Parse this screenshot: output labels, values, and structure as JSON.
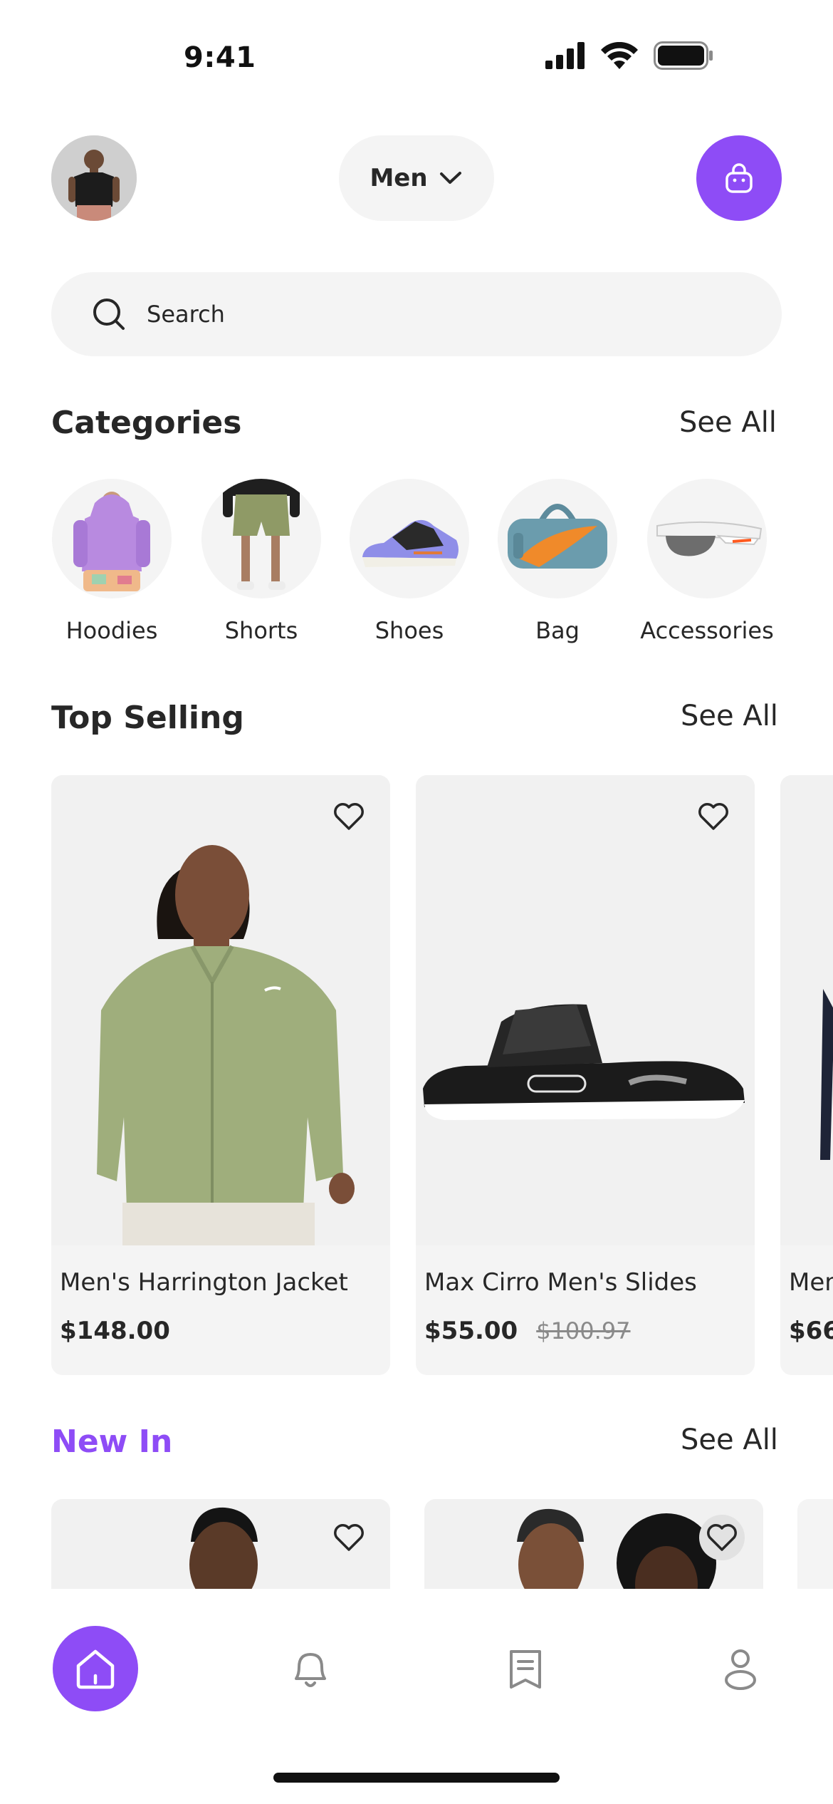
{
  "status_bar": {
    "time": "9:41"
  },
  "header": {
    "gender_selected": "Men",
    "avatar_icon": "user-avatar",
    "cart_icon": "shopping-bag-icon"
  },
  "search": {
    "placeholder": "Search"
  },
  "categories": {
    "title": "Categories",
    "see_all": "See All",
    "items": [
      {
        "label": "Hoodies",
        "icon": "hoodie-image"
      },
      {
        "label": "Shorts",
        "icon": "shorts-image"
      },
      {
        "label": "Shoes",
        "icon": "shoe-image"
      },
      {
        "label": "Bag",
        "icon": "bag-image"
      },
      {
        "label": "Accessories",
        "icon": "sunglasses-image"
      }
    ]
  },
  "top_selling": {
    "title": "Top Selling",
    "see_all": "See All",
    "products": [
      {
        "name": "Men's Harrington Jacket",
        "price": "$148.00",
        "old_price": ""
      },
      {
        "name": "Max Cirro Men's Slides",
        "price": "$55.00",
        "old_price": "$100.97"
      },
      {
        "name": "Men",
        "price": "$66",
        "old_price": ""
      }
    ]
  },
  "new_in": {
    "title": "New In",
    "see_all": "See All"
  },
  "bottom_nav": {
    "items": [
      "home-icon",
      "bell-icon",
      "receipt-icon",
      "profile-icon"
    ]
  },
  "colors": {
    "accent": "#8E4CF6",
    "surface": "#F4F4F4",
    "text": "#272727"
  }
}
